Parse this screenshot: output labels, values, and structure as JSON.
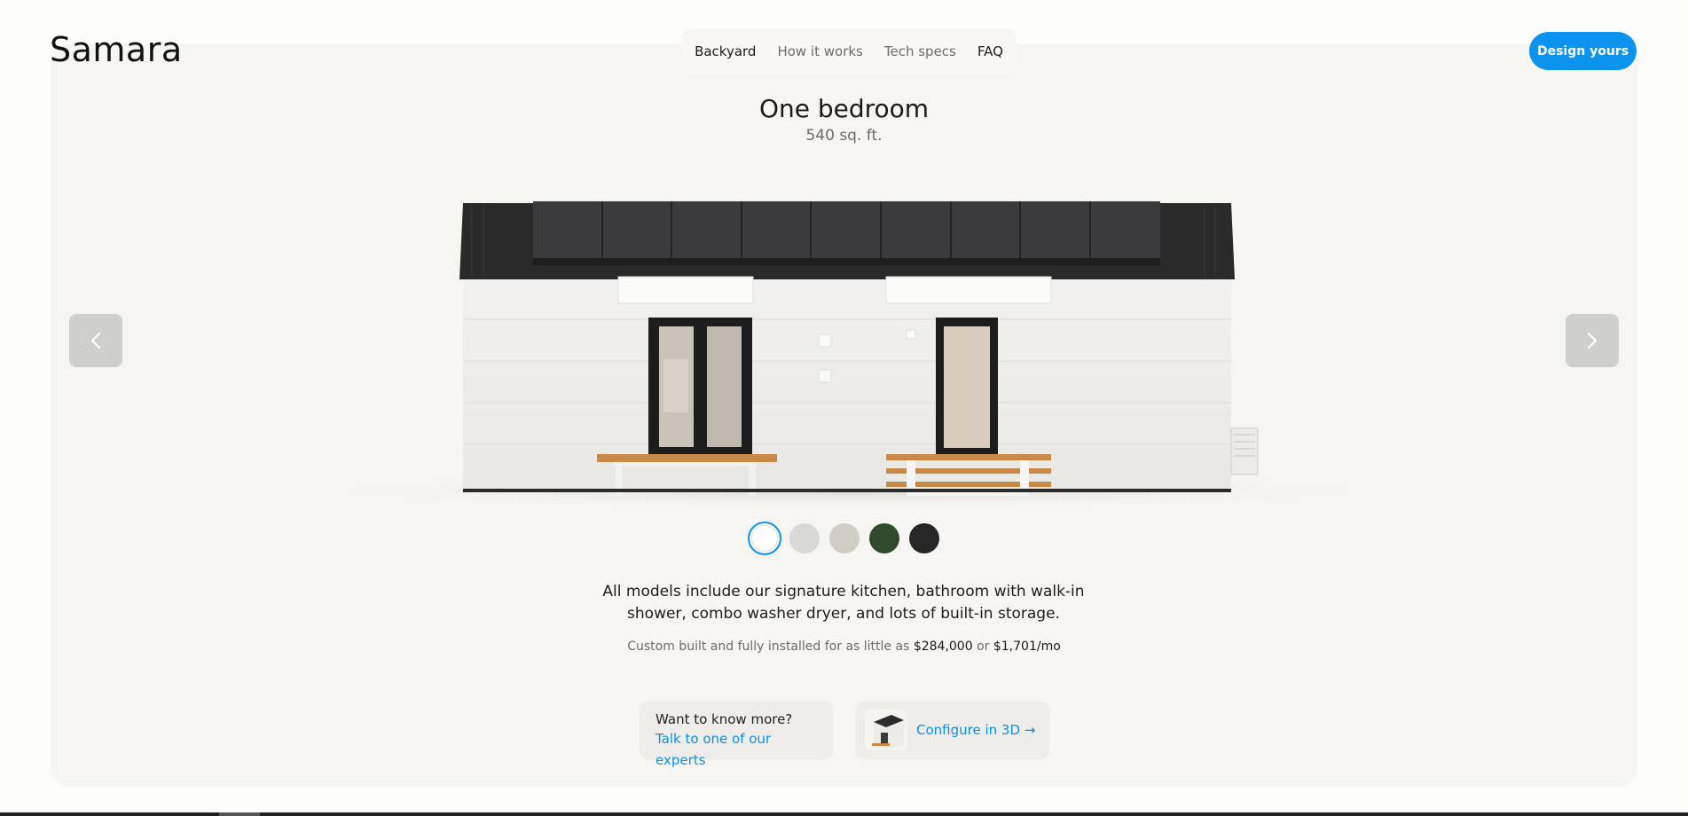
{
  "brand": {
    "logo_text": "Samara"
  },
  "nav": {
    "items": [
      {
        "label": "Backyard"
      },
      {
        "label": "How it works"
      },
      {
        "label": "Tech specs"
      },
      {
        "label": "FAQ"
      }
    ]
  },
  "header": {
    "cta_label": "Design yours",
    "cta_color": "#0b93ee"
  },
  "model": {
    "title": "One bedroom",
    "area": "540 sq. ft."
  },
  "carousel": {
    "prev_icon": "chevron-left-icon",
    "next_icon": "chevron-right-icon"
  },
  "swatches": [
    {
      "color": "#ffffff",
      "selected": true
    },
    {
      "color": "#d8d8d6",
      "selected": false
    },
    {
      "color": "#cfcdc6",
      "selected": false
    },
    {
      "color": "#2f4a2c",
      "selected": false
    },
    {
      "color": "#272727",
      "selected": false
    }
  ],
  "description": "All models include our signature kitchen, bathroom with walk-in shower, combo washer dryer, and lots of built-in storage.",
  "pricing": {
    "prefix": "Custom built and fully installed for as little as ",
    "price": "$284,000",
    "joiner": " or ",
    "monthly": "$1,701/mo"
  },
  "experts_card": {
    "question": "Want to know more?",
    "link": "Talk to one of our experts"
  },
  "configure_card": {
    "link": "Configure in 3D →"
  }
}
